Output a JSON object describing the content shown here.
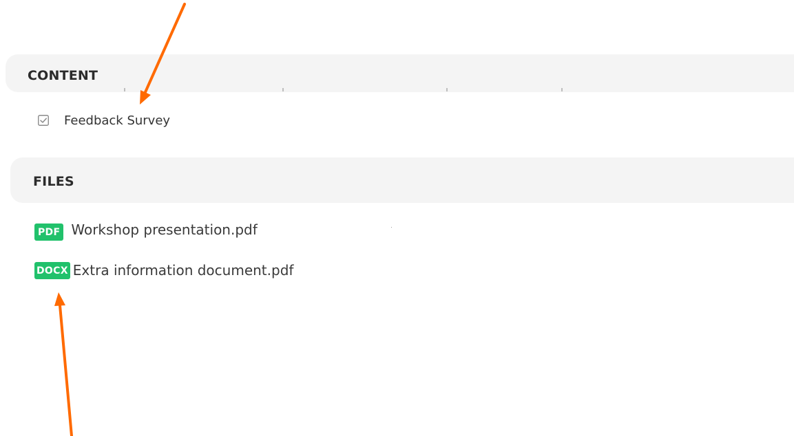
{
  "content_section": {
    "title": "CONTENT",
    "items": [
      {
        "label": "Feedback Survey",
        "icon": "checkbox-checked-icon",
        "checked": true
      }
    ]
  },
  "files_section": {
    "title": "FILES",
    "files": [
      {
        "badge": "PDF",
        "name": "Workshop presentation.pdf"
      },
      {
        "badge": "DOCX",
        "name": "Extra information document.pdf"
      }
    ]
  },
  "colors": {
    "badge": "#21c16b",
    "section_background": "#f4f4f4",
    "arrow": "#ff6a00",
    "text": "#333333"
  }
}
